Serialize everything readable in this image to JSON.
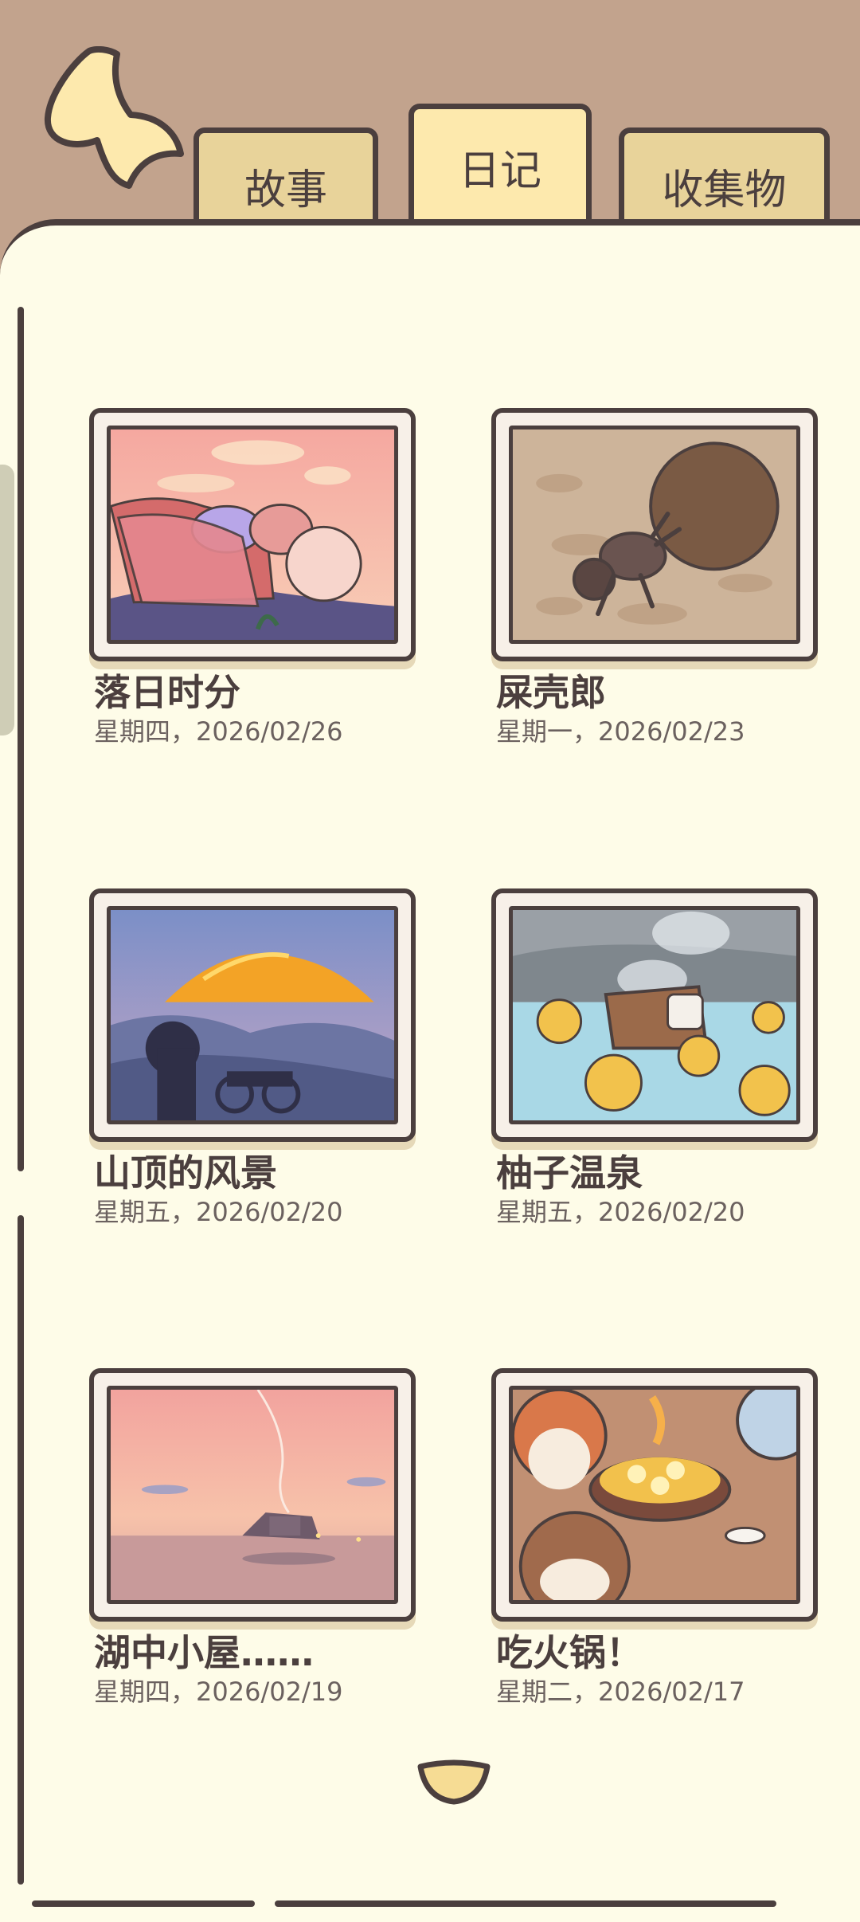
{
  "tabs": [
    {
      "label": "故事",
      "active": false
    },
    {
      "label": "日记",
      "active": true
    },
    {
      "label": "收集物",
      "active": false
    }
  ],
  "entries": [
    {
      "title": "落日时分",
      "date": "星期四，2026/02/26",
      "scene": "sunset-picnic"
    },
    {
      "title": "屎壳郎",
      "date": "星期一，2026/02/23",
      "scene": "dung-beetle"
    },
    {
      "title": "山顶的风景",
      "date": "星期五，2026/02/20",
      "scene": "mountain-view"
    },
    {
      "title": "柚子温泉",
      "date": "星期五，2026/02/20",
      "scene": "yuzu-hot-spring"
    },
    {
      "title": "湖中小屋……",
      "date": "星期四，2026/02/19",
      "scene": "lake-cabin"
    },
    {
      "title": "吃火锅！",
      "date": "星期二，2026/02/17",
      "scene": "hotpot"
    }
  ],
  "colors": {
    "outline": "#4b3f3e",
    "page": "#fefce8",
    "background": "#c2a38d",
    "tab": "#e8d39a",
    "tab_active": "#fde9ad"
  },
  "icons": [
    "back-arrow-icon",
    "scroll-down-icon"
  ]
}
